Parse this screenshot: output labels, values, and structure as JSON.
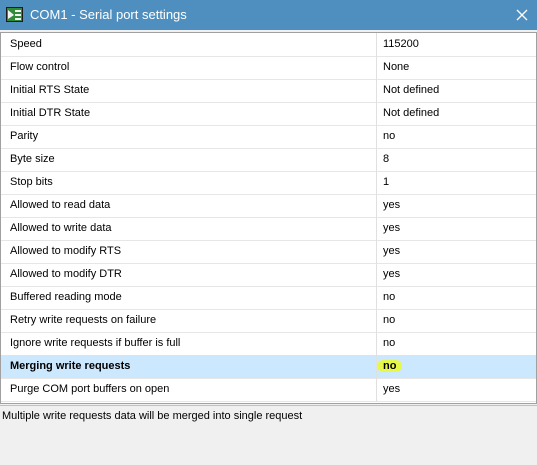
{
  "window": {
    "title": "COM1 - Serial port settings",
    "icon": "serial-port-app-icon",
    "close_icon": "close-icon"
  },
  "settings": [
    {
      "label": "Speed",
      "value": "115200"
    },
    {
      "label": "Flow control",
      "value": "None"
    },
    {
      "label": "Initial RTS State",
      "value": "Not defined"
    },
    {
      "label": "Initial DTR State",
      "value": "Not defined"
    },
    {
      "label": "Parity",
      "value": "no"
    },
    {
      "label": "Byte size",
      "value": "8"
    },
    {
      "label": "Stop bits",
      "value": "1"
    },
    {
      "label": "Allowed to read data",
      "value": "yes"
    },
    {
      "label": "Allowed to write data",
      "value": "yes"
    },
    {
      "label": "Allowed to modify RTS",
      "value": "yes"
    },
    {
      "label": "Allowed to modify DTR",
      "value": "yes"
    },
    {
      "label": "Buffered reading mode",
      "value": "no"
    },
    {
      "label": "Retry write requests on failure",
      "value": "no"
    },
    {
      "label": "Ignore write requests if buffer is full",
      "value": "no"
    },
    {
      "label": "Merging write requests",
      "value": "no",
      "selected": true
    },
    {
      "label": "Purge COM port buffers on open",
      "value": "yes"
    }
  ],
  "status": {
    "description": "Multiple write requests data will be merged into single request"
  },
  "colors": {
    "titlebar": "#4f8fc0",
    "selected_row": "#cce8ff",
    "highlight": "#e8f84a"
  }
}
